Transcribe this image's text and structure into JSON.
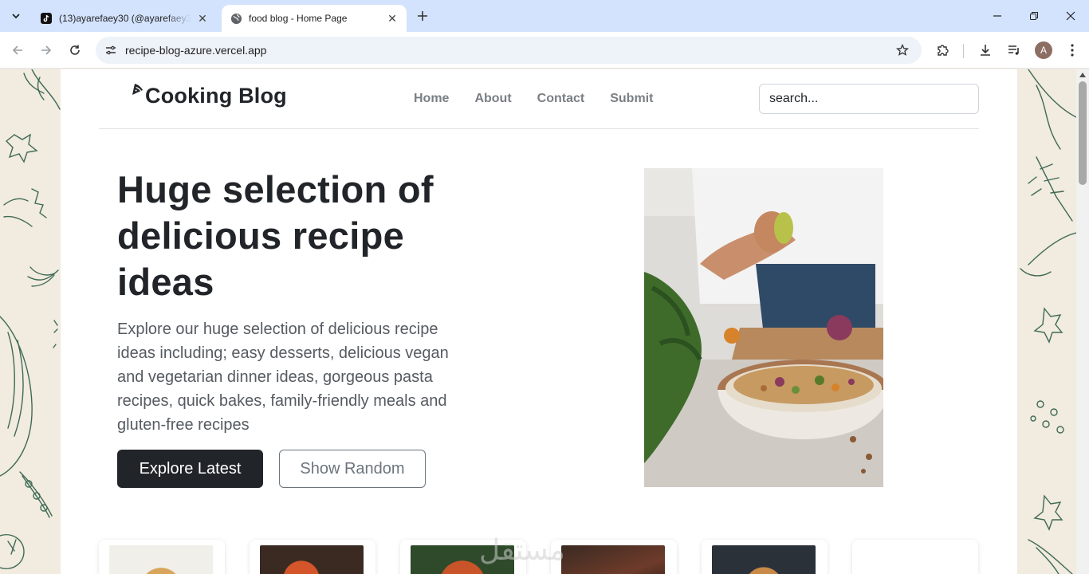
{
  "browser": {
    "tabs": [
      {
        "title": "(13)ayarefaey30 (@ayarefaey30",
        "icon": "tiktok-icon",
        "active": false
      },
      {
        "title": "food blog - Home Page",
        "icon": "globe-icon",
        "active": true
      }
    ],
    "url": "recipe-blog-azure.vercel.app",
    "profile_initial": "A"
  },
  "site": {
    "brand": "Cooking Blog",
    "nav": [
      {
        "label": "Home"
      },
      {
        "label": "About"
      },
      {
        "label": "Contact"
      },
      {
        "label": "Submit"
      }
    ],
    "search_placeholder": "search..."
  },
  "hero": {
    "title": "Huge selection of delicious recipe ideas",
    "text": "Explore our huge selection of delicious recipe ideas including; easy desserts, delicious vegan and vegetarian dinner ideas, gorgeous pasta recipes, quick bakes, family-friendly meals and gluten-free recipes",
    "primary_button": "Explore Latest",
    "secondary_button": "Show Random"
  },
  "watermark": "مستقل",
  "colors": {
    "dark_button": "#212529",
    "nav_text": "#7a7f84",
    "tab_strip": "#d3e3fd",
    "page_background": "#f1ebe0"
  }
}
